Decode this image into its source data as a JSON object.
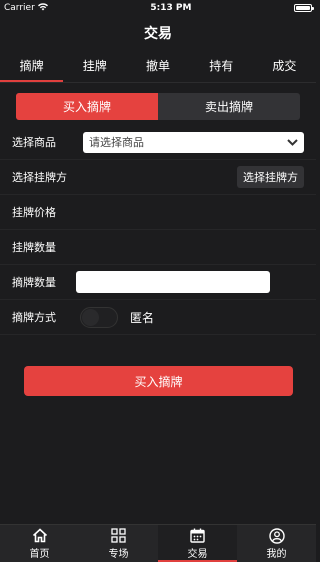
{
  "status": {
    "carrier": "Carrier",
    "time": "5:13 PM"
  },
  "nav": {
    "title": "交易"
  },
  "tabs": [
    {
      "label": "摘牌",
      "active": true
    },
    {
      "label": "挂牌",
      "active": false
    },
    {
      "label": "撤单",
      "active": false
    },
    {
      "label": "持有",
      "active": false
    },
    {
      "label": "成交",
      "active": false
    }
  ],
  "segment": {
    "buy": "买入摘牌",
    "sell": "卖出摘牌",
    "active": "buy"
  },
  "form": {
    "product_label": "选择商品",
    "product_placeholder": "请选择商品",
    "counterparty_label": "选择挂牌方",
    "counterparty_button": "选择挂牌方",
    "price_label": "挂牌价格",
    "quantity_label": "挂牌数量",
    "delist_qty_label": "摘牌数量",
    "delist_qty_value": "",
    "method_label": "摘牌方式",
    "anonymous_label": "匿名",
    "anonymous_on": false
  },
  "submit_label": "买入摘牌",
  "tabbar": [
    {
      "label": "首页",
      "icon": "home-icon",
      "active": false
    },
    {
      "label": "专场",
      "icon": "grid-icon",
      "active": false
    },
    {
      "label": "交易",
      "icon": "calendar-icon",
      "active": true
    },
    {
      "label": "我的",
      "icon": "user-icon",
      "active": false
    }
  ],
  "colors": {
    "accent": "#e5423f",
    "background": "#1c1c1e"
  }
}
